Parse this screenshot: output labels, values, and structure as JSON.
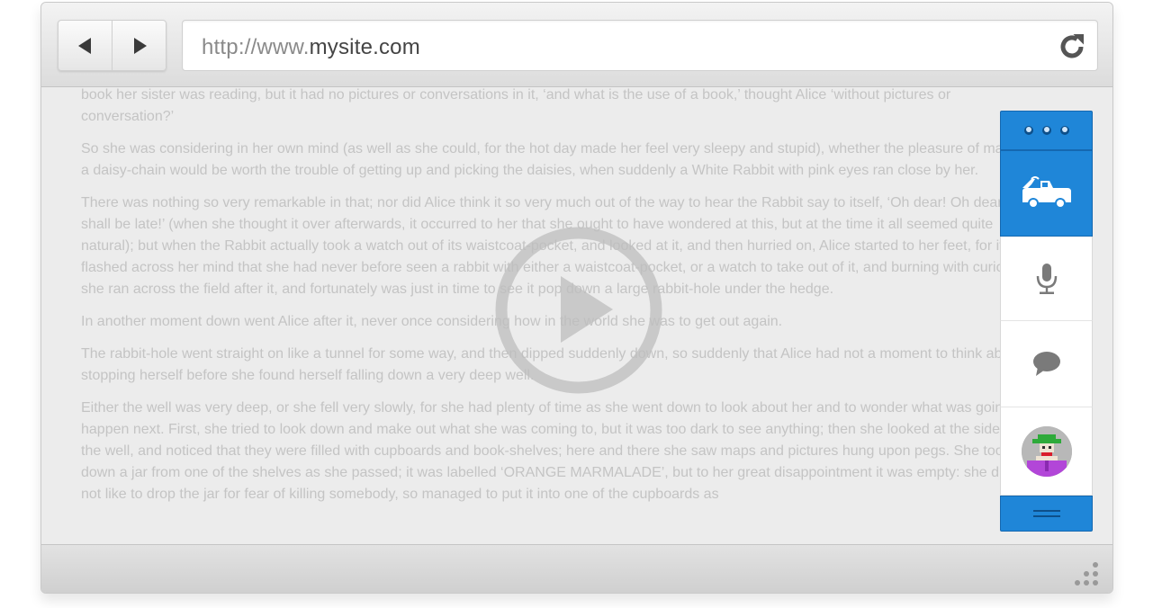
{
  "browser": {
    "url_prefix": "http://www.",
    "url_domain": "mysite.com"
  },
  "icons": {
    "back": "arrow-left-icon",
    "forward": "arrow-right-icon",
    "reload": "reload-icon",
    "play": "play-icon",
    "more": "more-dots-icon",
    "tow_truck": "tow-truck-icon",
    "microphone": "microphone-icon",
    "chat": "chat-bubble-icon",
    "menu": "hamburger-menu-icon",
    "grip": "resize-grip-icon"
  },
  "colors": {
    "accent_blue": "#1f86d8",
    "text_faded": "#c4c4c4",
    "frame_bg": "#ececec"
  },
  "article": {
    "paragraphs": [
      "book her sister was reading, but it had no pictures or conversations in it, ‘and what is the use of a book,’ thought Alice ‘without pictures or conversation?’",
      "So she was considering in her own mind (as well as she could, for the hot day made her feel very sleepy and stupid), whether the pleasure of making a daisy-chain would be worth the trouble of getting up and picking the daisies, when suddenly a White Rabbit with pink eyes ran close by her.",
      "There was nothing so very remarkable in that; nor did Alice think it so very much out of the way to hear the Rabbit say to itself, ‘Oh dear! Oh dear! I shall be late!’ (when she thought it over afterwards, it occurred to her that she ought to have wondered at this, but at the time it all seemed quite natural); but when the Rabbit actually took a watch out of its waistcoat-pocket, and looked at it, and then hurried on, Alice started to her feet, for it flashed across her mind that she had never before seen a rabbit with either a waistcoat-pocket, or a watch to take out of it, and burning with curiosity, she ran across the field after it, and fortunately was just in time to see it pop down a large rabbit-hole under the hedge.",
      "In another moment down went Alice after it, never once considering how in the world she was to get out again.",
      "The rabbit-hole went straight on like a tunnel for some way, and then dipped suddenly down, so suddenly that Alice had not a moment to think about stopping herself before she found herself falling down a very deep well.",
      "Either the well was very deep, or she fell very slowly, for she had plenty of time as she went down to look about her and to wonder what was going to happen next. First, she tried to look down and make out what she was coming to, but it was too dark to see anything; then she looked at the sides of the well, and noticed that they were filled with cupboards and book-shelves; here and there she saw maps and pictures hung upon pegs. She took down a jar from one of the shelves as she passed; it was labelled ‘ORANGE MARMALADE’, but to her great disappointment it was empty: she did not like to drop the jar for fear of killing somebody, so managed to put it into one of the cupboards as"
    ]
  }
}
